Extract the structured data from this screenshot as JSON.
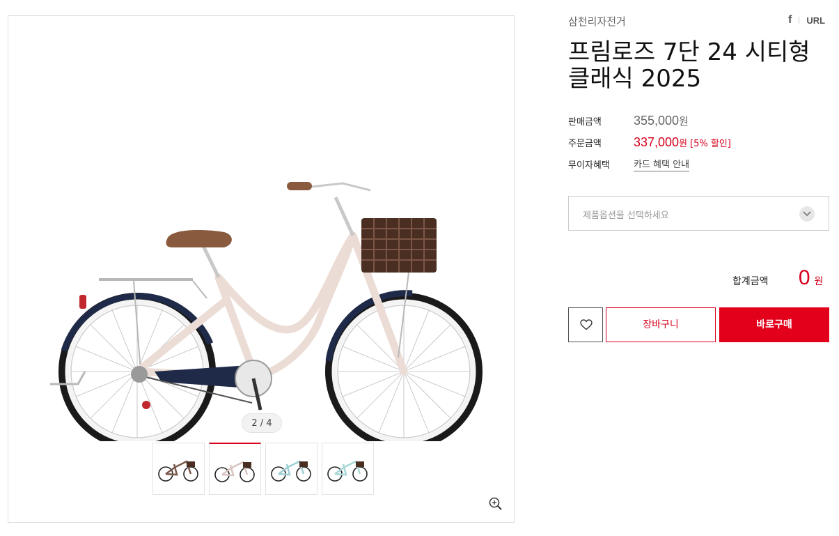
{
  "product": {
    "brand": "삼천리자전거",
    "title": "프림로즈 7단 24 시티형 클래식 2025"
  },
  "share": {
    "facebook_label": "f",
    "url_label": "URL"
  },
  "gallery": {
    "counter": "2 / 4",
    "active_index": 2,
    "thumbnails": [
      {
        "name": "brown",
        "frame_color": "#7b5a4c"
      },
      {
        "name": "pink",
        "frame_color": "#e8d8d4"
      },
      {
        "name": "mint",
        "frame_color": "#b6dcdf"
      },
      {
        "name": "mint-light",
        "frame_color": "#bfe1e0"
      }
    ]
  },
  "pricing": {
    "sale_label": "판매금액",
    "sale_price": "355,000",
    "sale_unit": "원",
    "order_label": "주문금액",
    "order_price": "337,000",
    "order_unit": "원",
    "discount": "[5% 할인]",
    "benefit_label": "무이자혜택",
    "benefit_link": "카드 혜택 안내"
  },
  "options": {
    "placeholder": "제품옵션을 선택하세요"
  },
  "total": {
    "label": "합계금액",
    "value": "0",
    "unit": "원"
  },
  "actions": {
    "cart_label": "장바구니",
    "buy_label": "바로구매"
  },
  "colors": {
    "accent": "#e2001a",
    "frame": "#efe1dc",
    "fender": "#1f2a48"
  }
}
